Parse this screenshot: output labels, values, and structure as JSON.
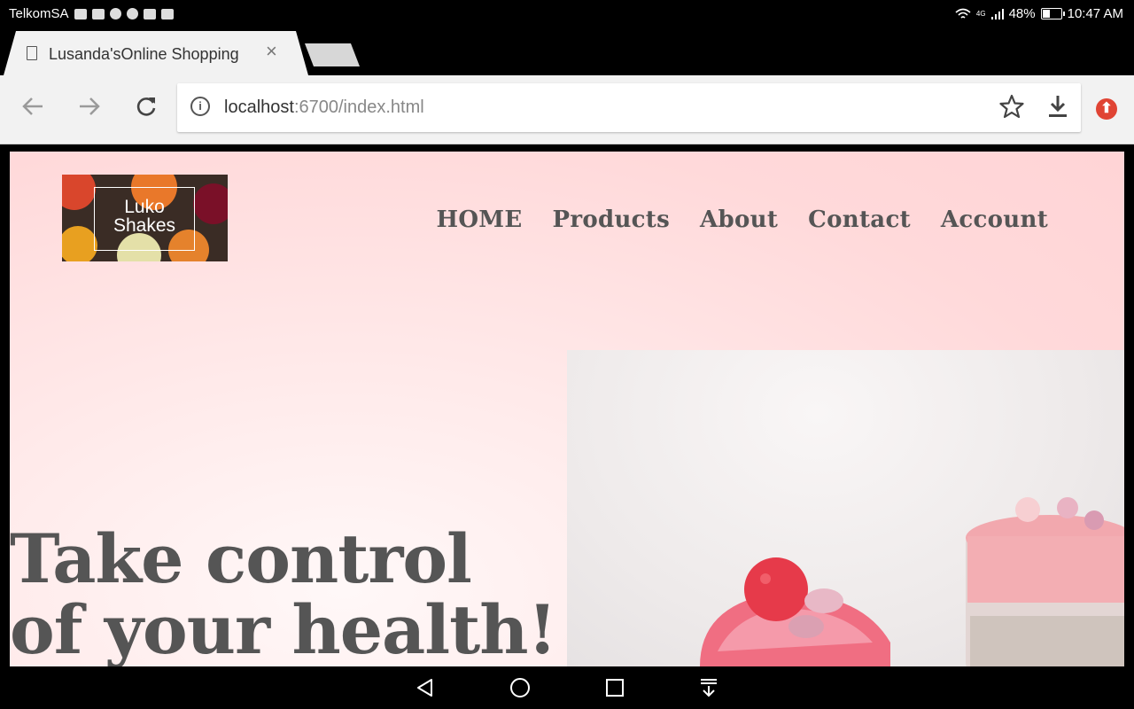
{
  "status_bar": {
    "carrier": "TelkomSA",
    "network": "4G",
    "battery": "48%",
    "battery_level": 0.48,
    "time": "10:47 AM"
  },
  "browser": {
    "tab": {
      "title": "Lusanda'sOnline Shopping",
      "close": "×"
    },
    "url": {
      "host": "localhost",
      "rest": ":6700/index.html"
    }
  },
  "site": {
    "logo": {
      "line1": "Luko",
      "line2": "Shakes"
    },
    "nav": [
      "HOME",
      "Products",
      "About",
      "Contact",
      "Account"
    ],
    "hero": {
      "line1": "Take control",
      "line2": "of your health!"
    }
  }
}
